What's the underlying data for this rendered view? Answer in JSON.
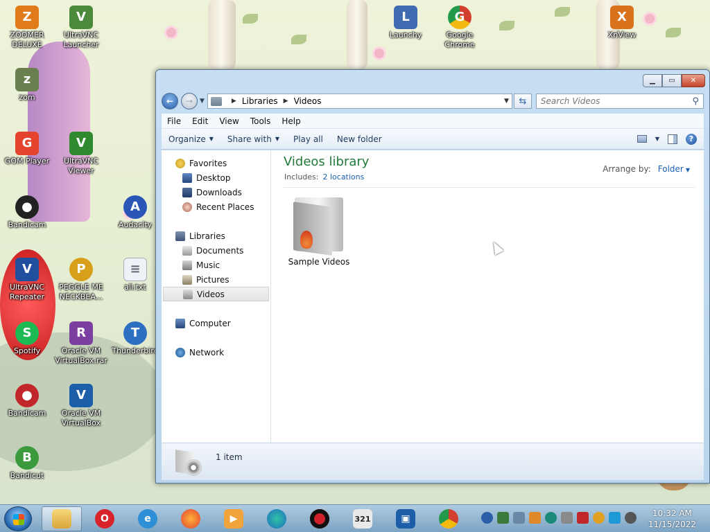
{
  "desktop": {
    "icons": [
      {
        "label": "ZOOMER\nDELUXE",
        "glyph": "Z",
        "color": "#e07b1a"
      },
      {
        "label": "UltraVNC\nLauncher",
        "glyph": "V",
        "color": "#4a8a3a"
      },
      {
        "label": "Launchy",
        "glyph": "L",
        "color": "#3f6bb0"
      },
      {
        "label": "Google\nChrome",
        "glyph": "G",
        "color": "#d33f2f"
      },
      {
        "label": "XnView",
        "glyph": "X",
        "color": "#d8731c"
      },
      {
        "label": "zom",
        "glyph": "z",
        "color": "#6a7f4e"
      },
      {
        "label": "GOM Player",
        "glyph": "G",
        "color": "#e4442e"
      },
      {
        "label": "UltraVNC\nViewer",
        "glyph": "V",
        "color": "#2f8a2f"
      },
      {
        "label": "Bandicam",
        "glyph": "●",
        "color": "#222222"
      },
      {
        "label": "Audacity",
        "glyph": "A",
        "color": "#2a56b8"
      },
      {
        "label": "UltraVNC\nRepeater",
        "glyph": "V",
        "color": "#1f4f9e"
      },
      {
        "label": "PEGGLE ME\nNECKBEA...",
        "glyph": "P",
        "color": "#d8a01a"
      },
      {
        "label": "all.txt",
        "glyph": "≡",
        "color": "#c9ced6"
      },
      {
        "label": "Spotify",
        "glyph": "S",
        "color": "#1db954"
      },
      {
        "label": "Oracle VM\nVirtualBox.rar",
        "glyph": "R",
        "color": "#7b3fa0"
      },
      {
        "label": "Thunderbird",
        "glyph": "T",
        "color": "#2d6fc1"
      },
      {
        "label": "Bandicam",
        "glyph": "●",
        "color": "#c0262a"
      },
      {
        "label": "Oracle VM\nVirtualBox",
        "glyph": "V",
        "color": "#1c5fa8"
      },
      {
        "label": "Bandicut",
        "glyph": "B",
        "color": "#3b9a3b"
      }
    ]
  },
  "window": {
    "address": {
      "root": "Libraries",
      "current": "Videos"
    },
    "search_placeholder": "Search Videos",
    "menu": [
      "File",
      "Edit",
      "View",
      "Tools",
      "Help"
    ],
    "commands": {
      "organize": "Organize",
      "share": "Share with",
      "play_all": "Play all",
      "new_folder": "New folder"
    },
    "nav": {
      "favorites": "Favorites",
      "desktop": "Desktop",
      "downloads": "Downloads",
      "recent": "Recent Places",
      "libraries": "Libraries",
      "documents": "Documents",
      "music": "Music",
      "pictures": "Pictures",
      "videos": "Videos",
      "computer": "Computer",
      "network": "Network"
    },
    "library": {
      "title": "Videos library",
      "includes_label": "Includes:",
      "includes_link": "2 locations",
      "arrange_label": "Arrange by:",
      "arrange_value": "Folder"
    },
    "items": [
      {
        "label": "Sample Videos"
      }
    ],
    "status": "1 item"
  },
  "taskbar": {
    "time": "10:32 AM",
    "date": "11/15/2022"
  }
}
